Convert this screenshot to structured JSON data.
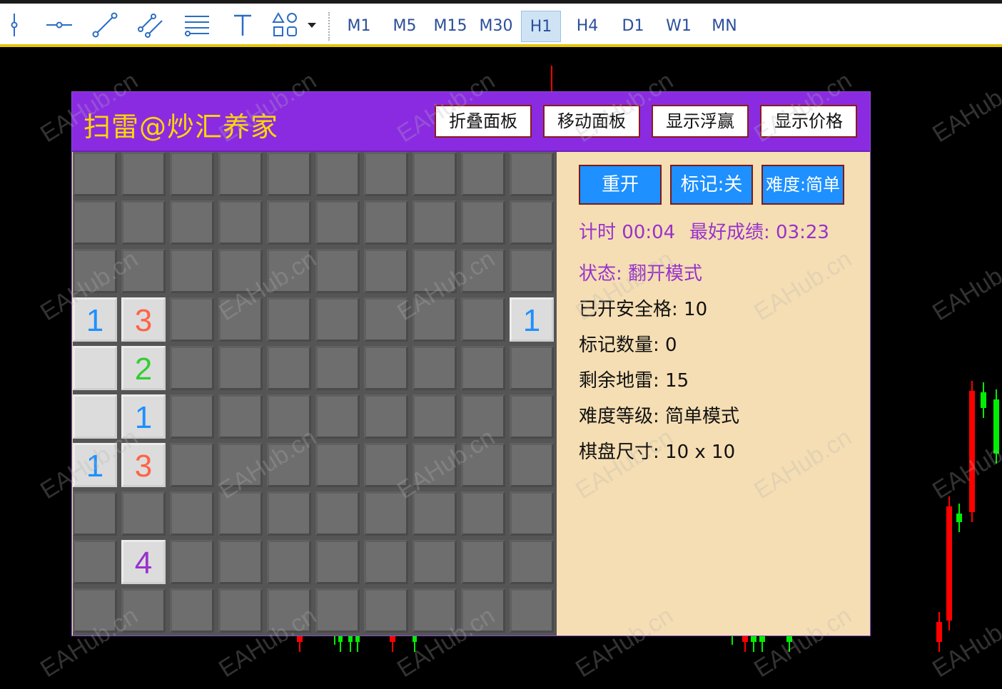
{
  "toolbar": {
    "tools": [
      "vertical-line-icon",
      "horizontal-line-icon",
      "trendline-icon",
      "channel-icon",
      "fibonacci-icon",
      "text-icon",
      "shapes-icon",
      "dropdown-arrow-icon"
    ],
    "timeframes": [
      "M1",
      "M5",
      "M15",
      "M30",
      "H1",
      "H4",
      "D1",
      "W1",
      "MN"
    ],
    "active_timeframe": "H1"
  },
  "watermark": "EAHub.cn",
  "panel": {
    "title": "扫雷@炒汇养家",
    "header_buttons": [
      "折叠面板",
      "移动面板",
      "显示浮赢",
      "显示价格"
    ],
    "controls": {
      "restart": "重开",
      "mark": "标记:关",
      "difficulty": "难度:简单"
    },
    "timer": "计时 00:04",
    "best": "最好成绩: 03:23",
    "state": "状态: 翻开模式",
    "stats": [
      "已开安全格: 10",
      "标记数量: 0",
      "剩余地雷: 15",
      "难度等级: 简单模式",
      "棋盘尺寸: 10 x 10"
    ],
    "colors": {
      "header_bg": "#8a2be2",
      "title": "#ffd700",
      "panel_bg": "#f5deb3",
      "button_blue": "#1e90ff",
      "status_purple": "#9932cc"
    }
  },
  "board": {
    "rows": 10,
    "cols": 10,
    "open_cells": [
      {
        "r": 3,
        "c": 0,
        "v": "1",
        "color": "#1e90ff"
      },
      {
        "r": 3,
        "c": 1,
        "v": "3",
        "color": "#ff6347"
      },
      {
        "r": 3,
        "c": 9,
        "v": "1",
        "color": "#1e90ff"
      },
      {
        "r": 4,
        "c": 0,
        "v": "",
        "color": ""
      },
      {
        "r": 4,
        "c": 1,
        "v": "2",
        "color": "#32cd32"
      },
      {
        "r": 5,
        "c": 0,
        "v": "",
        "color": ""
      },
      {
        "r": 5,
        "c": 1,
        "v": "1",
        "color": "#1e90ff"
      },
      {
        "r": 6,
        "c": 0,
        "v": "1",
        "color": "#1e90ff"
      },
      {
        "r": 6,
        "c": 1,
        "v": "3",
        "color": "#ff6347"
      },
      {
        "r": 8,
        "c": 1,
        "v": "4",
        "color": "#9932cc"
      }
    ]
  }
}
